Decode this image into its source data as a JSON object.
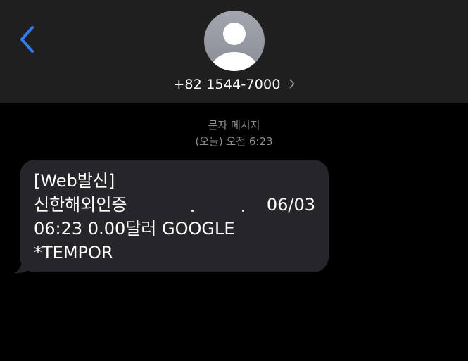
{
  "header": {
    "contact_number": "+82 1544-7000",
    "background": "#1f1f1f"
  },
  "icons": {
    "back": "chevron-left-icon",
    "avatar": "person-silhouette-icon",
    "contact_details": "chevron-right-icon"
  },
  "conversation": {
    "sender_label": "문자 메시지",
    "timestamp": "(오늘) 오전 6:23"
  },
  "message": {
    "lines": [
      "[Web발신]",
      "신한해외인증                          06/03",
      "06:23 0.00달러 GOOGLE",
      "*TEMPOR"
    ],
    "bubble_color": "#26252a"
  },
  "colors": {
    "accent": "#2f7cf6",
    "meta_text": "#8e8e93"
  }
}
